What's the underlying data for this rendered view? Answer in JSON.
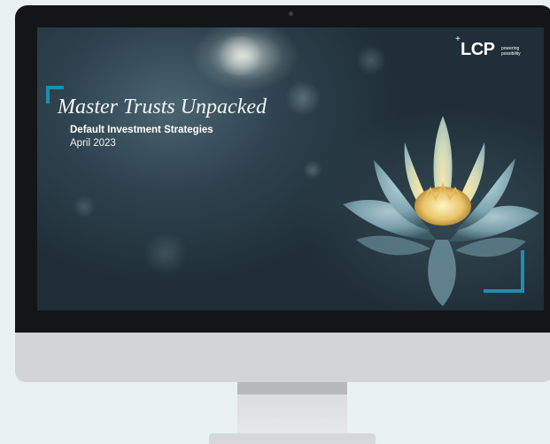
{
  "slide": {
    "title": "Master Trusts Unpacked",
    "subtitle": "Default Investment Strategies",
    "date": "April 2023"
  },
  "logo": {
    "mark": "LCP",
    "plus": "+",
    "tagline": "powering possibility"
  },
  "colors": {
    "accent": "#1b8fb0",
    "background": "#e9f1f3",
    "bezel": "#141516",
    "chin": "#d3d4d6"
  },
  "icons": {
    "decoration": "lotus-flower-image"
  }
}
